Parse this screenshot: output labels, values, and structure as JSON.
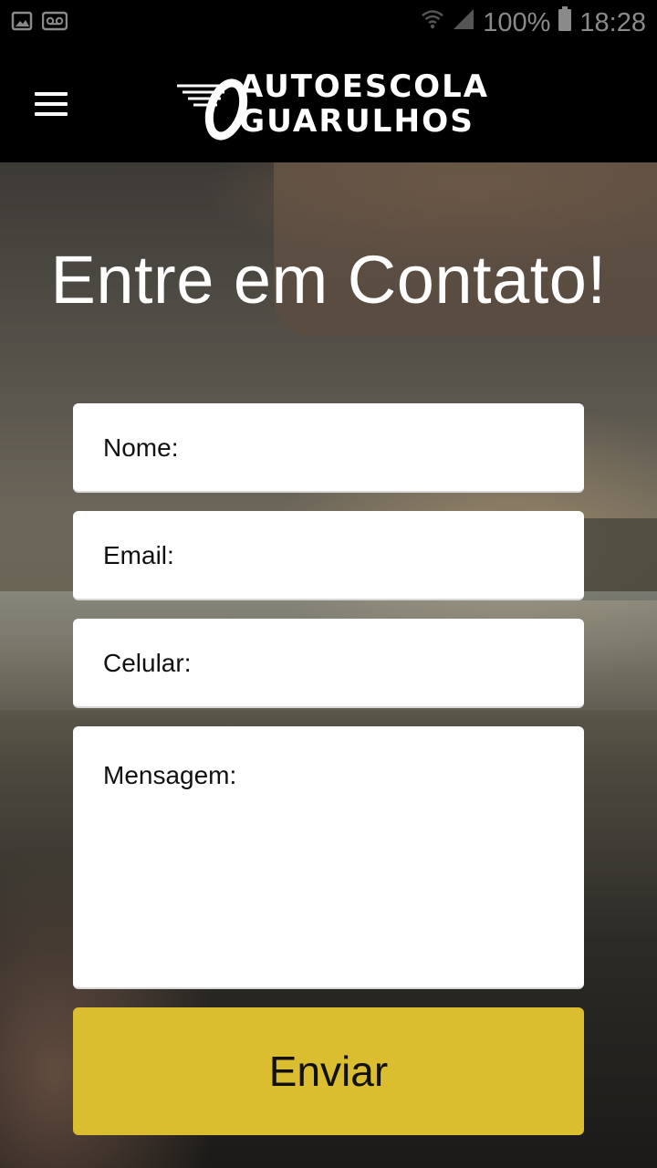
{
  "status_bar": {
    "left_icons": [
      "image-icon",
      "voicemail-icon"
    ],
    "right_icons": [
      "wifi-icon",
      "signal-icon",
      "battery-icon"
    ],
    "battery": "100%",
    "time": "18:28"
  },
  "app_bar": {
    "logo_line1": "AUTOESCOLA",
    "logo_line2": "GUARULHOS"
  },
  "hero": {
    "title": "Entre em Contato!"
  },
  "form": {
    "name_label": "Nome:",
    "email_label": "Email:",
    "phone_label": "Celular:",
    "message_label": "Mensagem:",
    "submit_label": "Enviar"
  },
  "colors": {
    "submit_background": "#dbbd30",
    "app_bar_background": "#000000"
  }
}
